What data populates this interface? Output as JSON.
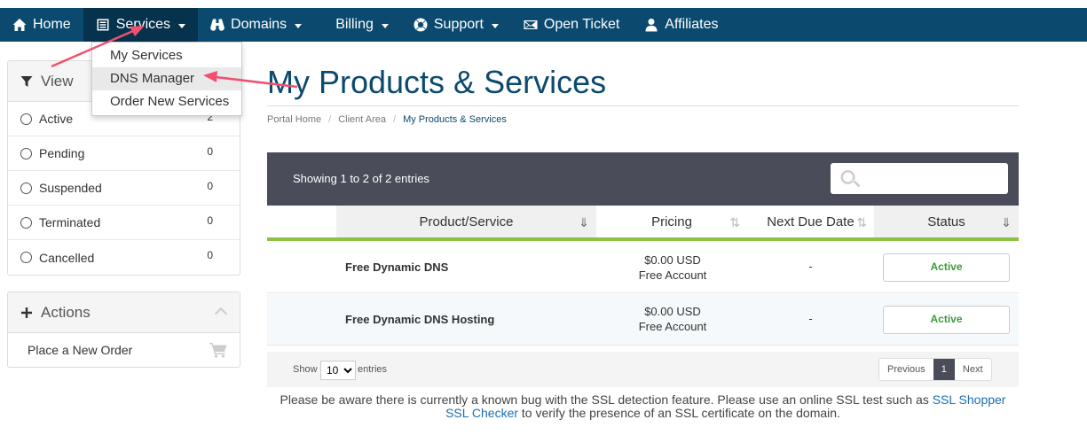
{
  "nav": {
    "items": [
      {
        "label": "Home",
        "icon": "home-icon"
      },
      {
        "label": "Services",
        "icon": "list-icon",
        "dropdown": true
      },
      {
        "label": "Domains",
        "icon": "binoculars-icon",
        "dropdown": true
      },
      {
        "label": "Billing",
        "icon": "",
        "dropdown": true
      },
      {
        "label": "Support",
        "icon": "lifebuoy-icon",
        "dropdown": true
      },
      {
        "label": "Open Ticket",
        "icon": "envelope-icon"
      },
      {
        "label": "Affiliates",
        "icon": "user-icon"
      }
    ]
  },
  "services_menu": {
    "items": [
      "My Services",
      "DNS Manager",
      "Order New Services"
    ],
    "highlighted": "DNS Manager"
  },
  "sidebar": {
    "view": {
      "title": "View",
      "statuses": [
        {
          "label": "Active",
          "count": "2"
        },
        {
          "label": "Pending",
          "count": "0"
        },
        {
          "label": "Suspended",
          "count": "0"
        },
        {
          "label": "Terminated",
          "count": "0"
        },
        {
          "label": "Cancelled",
          "count": "0"
        }
      ]
    },
    "actions": {
      "title": "Actions",
      "items": [
        "Place a New Order"
      ]
    }
  },
  "main": {
    "title": "My Products & Services",
    "breadcrumb": [
      "Portal Home",
      "Client Area",
      "My Products & Services"
    ],
    "table": {
      "info": "Showing 1 to 2 of 2 entries",
      "search_placeholder": "",
      "columns": [
        "Product/Service",
        "Pricing",
        "Next Due Date",
        "Status"
      ],
      "rows": [
        {
          "product": "Free Dynamic DNS",
          "price": "$0.00 USD",
          "billing": "Free Account",
          "due": "-",
          "status": "Active"
        },
        {
          "product": "Free Dynamic DNS Hosting",
          "price": "$0.00 USD",
          "billing": "Free Account",
          "due": "-",
          "status": "Active"
        }
      ],
      "footer": {
        "show_label": "Show",
        "page_size": "10",
        "entries_label": "entries",
        "pager": {
          "previous": "Previous",
          "current": "1",
          "next": "Next"
        }
      }
    },
    "notice": {
      "before": "Please be aware there is currently a known bug with the SSL detection feature. Please use an online SSL test such as ",
      "link": "SSL Shopper SSL Checker",
      "after": " to verify the presence of an SSL certificate on the domain."
    }
  },
  "colors": {
    "navbar": "#0b4a6e",
    "accent_green": "#8dc044",
    "status_active": "#3e9a3e",
    "annotation_arrow": "#f0506e"
  }
}
